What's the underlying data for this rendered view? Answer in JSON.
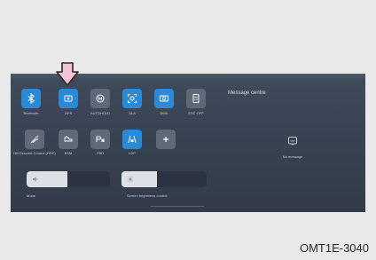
{
  "quick_settings": {
    "row1": [
      {
        "label": "Bluetooth",
        "icon": "bluetooth-icon",
        "state": "on"
      },
      {
        "label": "GPS",
        "icon": "gps-icon",
        "state": "on"
      },
      {
        "label": "AUTOHOLD",
        "icon": "autohold-icon",
        "state": "off"
      },
      {
        "label": "SLA",
        "icon": "sla-icon",
        "state": "on"
      },
      {
        "label": "DMS",
        "icon": "dms-icon",
        "state": "on"
      },
      {
        "label": "ESC OFF",
        "icon": "esc-off-icon",
        "state": "off"
      }
    ],
    "row2": [
      {
        "label": "Hill Descent Control (HDC)",
        "icon": "hdc-icon",
        "state": "off"
      },
      {
        "label": "BSM",
        "icon": "bsm-icon",
        "state": "off"
      },
      {
        "label": "FBD",
        "icon": "fbd-icon",
        "state": "off"
      },
      {
        "label": "LDP",
        "icon": "ldp-icon",
        "state": "on"
      },
      {
        "label": "",
        "icon": "add-icon",
        "state": "off"
      }
    ]
  },
  "sliders": {
    "volume": {
      "label": "Mode",
      "level": 0.49
    },
    "brightness": {
      "label": "Screen brightness control",
      "level": 0.42
    }
  },
  "message_centre": {
    "title": "Message centre",
    "empty_text": "No message"
  },
  "caption": "OMT1E-3040",
  "colors": {
    "tile_on": "#2b8ad6",
    "tile_off": "#5f6977",
    "screen_bg": "#3a4555",
    "arrow_fill": "#f4c3d4",
    "arrow_stroke": "#2a2a2a"
  }
}
